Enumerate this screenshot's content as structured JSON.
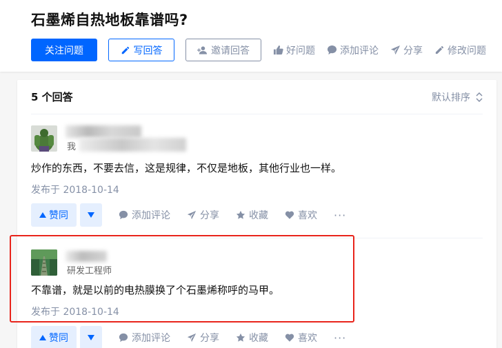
{
  "question": {
    "title": "石墨烯自热地板靠谱吗?"
  },
  "buttons": {
    "follow": "关注问题",
    "write": "写回答",
    "invite": "邀请回答"
  },
  "meta_actions": [
    {
      "label": "好问题",
      "icon": "thumb-up-icon"
    },
    {
      "label": "添加评论",
      "icon": "comment-icon"
    },
    {
      "label": "分享",
      "icon": "share-icon"
    },
    {
      "label": "修改问题",
      "icon": "pencil-icon"
    }
  ],
  "answers_header": {
    "count_label": "5 个回答",
    "sort_label": "默认排序"
  },
  "answers": [
    {
      "subtitle": "我",
      "content": "炒作的东西，不要去信，这是规律，不仅是地板，其他行业也一样。",
      "date": "发布于 2018-10-14"
    },
    {
      "subtitle": "研发工程师",
      "content": "不靠谱，就是以前的电热膜换了个石墨烯称呼的马甲。",
      "date": "发布于 2018-10-14"
    }
  ],
  "answer_actions": {
    "vote": "赞同",
    "comment": "添加评论",
    "share": "分享",
    "collect": "收藏",
    "like": "喜欢",
    "more": "···"
  },
  "colors": {
    "brand": "#0066ff",
    "muted": "#8590a6",
    "highlight": "#e8231a"
  }
}
